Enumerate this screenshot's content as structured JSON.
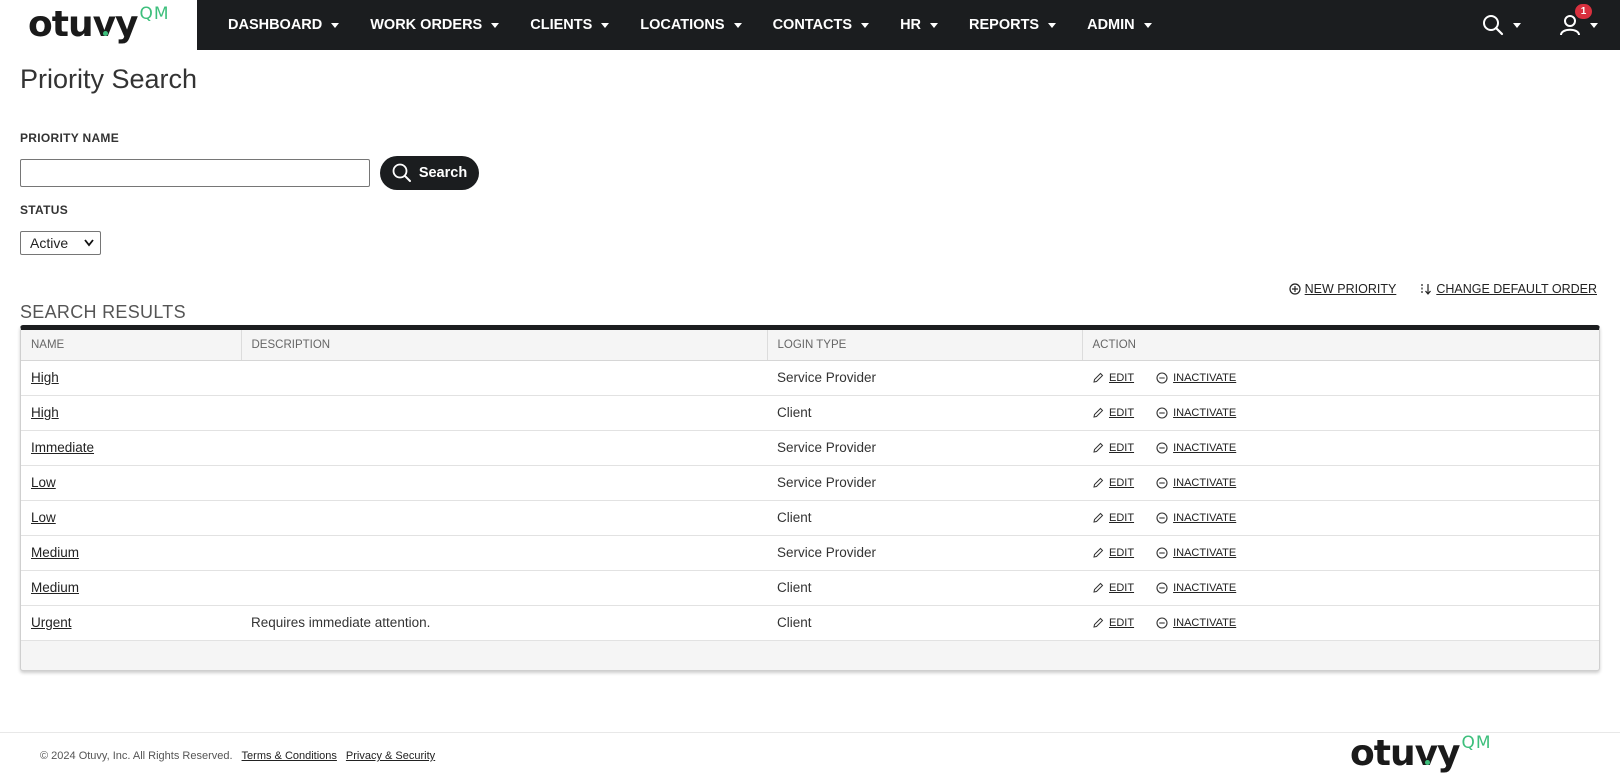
{
  "brand": {
    "logo_word_pre": "otu",
    "logo_v": "v",
    "logo_word_post": "y",
    "logo_suffix": "QM"
  },
  "nav": {
    "items": [
      "DASHBOARD",
      "WORK ORDERS",
      "CLIENTS",
      "LOCATIONS",
      "CONTACTS",
      "HR",
      "REPORTS",
      "ADMIN"
    ],
    "notification_count": "1",
    "icons": [
      "search-icon",
      "user-icon"
    ]
  },
  "page": {
    "title": "Priority Search"
  },
  "filters": {
    "priority_name_label": "PRIORITY NAME",
    "priority_name_value": "",
    "search_button": "Search",
    "status_label": "STATUS",
    "status_value": "Active"
  },
  "actions": {
    "new_priority": "NEW PRIORITY",
    "change_default_order": "CHANGE DEFAULT ORDER"
  },
  "results": {
    "title": "SEARCH RESULTS",
    "columns": [
      "NAME",
      "DESCRIPTION",
      "LOGIN TYPE",
      "ACTION"
    ],
    "row_actions": {
      "edit": "EDIT",
      "inactivate": "INACTIVATE"
    },
    "rows": [
      {
        "name": "High",
        "description": "",
        "login_type": "Service Provider"
      },
      {
        "name": "High",
        "description": "",
        "login_type": "Client"
      },
      {
        "name": "Immediate",
        "description": "",
        "login_type": "Service Provider"
      },
      {
        "name": "Low",
        "description": "",
        "login_type": "Service Provider"
      },
      {
        "name": "Low",
        "description": "",
        "login_type": "Client"
      },
      {
        "name": "Medium",
        "description": "",
        "login_type": "Service Provider"
      },
      {
        "name": "Medium",
        "description": "",
        "login_type": "Client"
      },
      {
        "name": "Urgent",
        "description": "Requires immediate attention.",
        "login_type": "Client"
      }
    ]
  },
  "footer": {
    "copyright": "© 2024 Otuvy, Inc. All Rights Reserved.",
    "terms": "Terms & Conditions",
    "privacy": "Privacy & Security"
  },
  "colors": {
    "nav_bg": "#1b1d1f",
    "brand_green": "#3dbf7c",
    "badge_red": "#d9303e"
  }
}
